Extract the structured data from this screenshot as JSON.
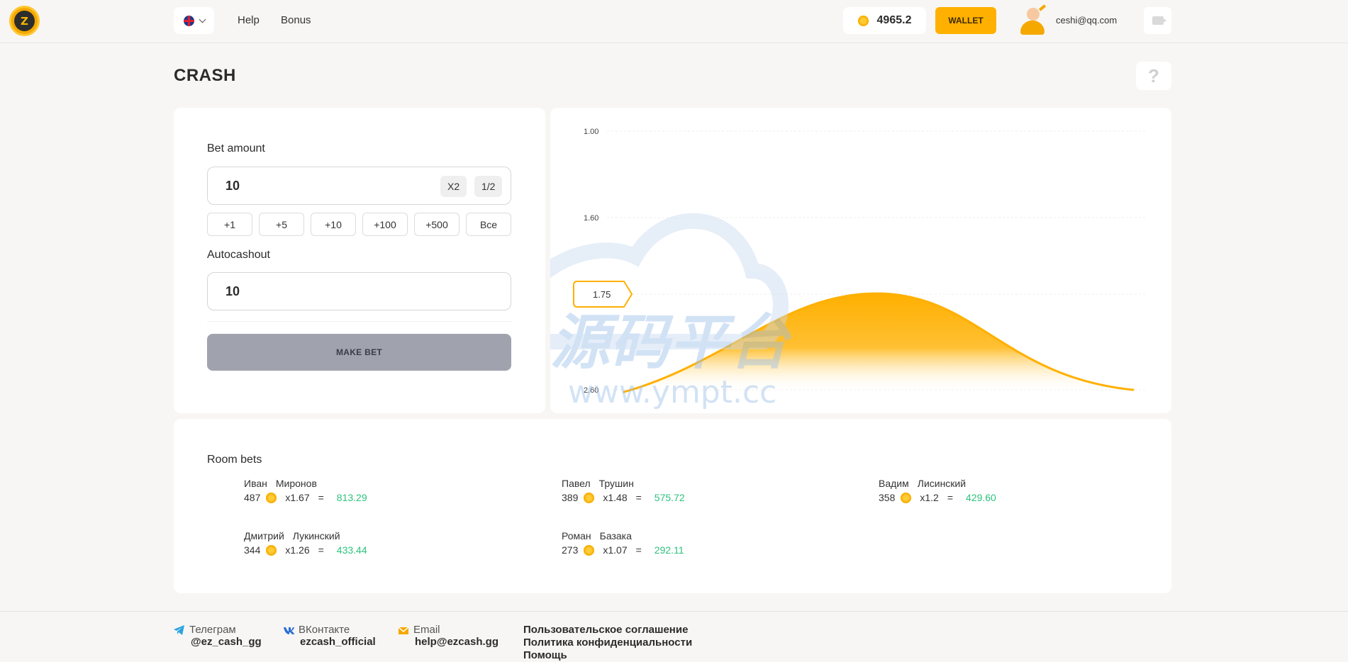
{
  "header": {
    "logo_text": "Z",
    "nav": [
      "Help",
      "Bonus"
    ],
    "balance": "4965.2",
    "wallet_label": "WALLET",
    "user_email": "ceshi@qq.com"
  },
  "page": {
    "title": "CRASH",
    "help_label": "?"
  },
  "bet_panel": {
    "bet_amount_label": "Bet amount",
    "bet_amount_value": "10",
    "x2_label": "X2",
    "half_label": "1/2",
    "quick_amounts": [
      "+1",
      "+5",
      "+10",
      "+100",
      "+500",
      "Все"
    ],
    "autocashout_label": "Autocashout",
    "autocashout_value": "10",
    "make_bet_label": "MAKE BET"
  },
  "chart_data": {
    "type": "area",
    "y_ticks": [
      "1.00",
      "1.60",
      "2.60"
    ],
    "current_multiplier": "1.75",
    "curve": "bell",
    "colors": {
      "line": "#ffb000",
      "fill_top": "#ffb000",
      "fill_bottom": "#ffffff"
    }
  },
  "watermark": {
    "text_cn": "源码平台",
    "url": "www.ympt.cc"
  },
  "room": {
    "title": "Room bets",
    "bets": [
      {
        "first": "Иван",
        "last": "Миронов",
        "amount": "487",
        "mult": "x1.67",
        "eq": "=",
        "win": "813.29"
      },
      {
        "first": "Павел",
        "last": "Трушин",
        "amount": "389",
        "mult": "x1.48",
        "eq": "=",
        "win": "575.72"
      },
      {
        "first": "Вадим",
        "last": "Лисинский",
        "amount": "358",
        "mult": "x1.2",
        "eq": "=",
        "win": "429.60"
      },
      {
        "first": "Дмитрий",
        "last": "Лукинский",
        "amount": "344",
        "mult": "x1.26",
        "eq": "=",
        "win": "433.44"
      },
      {
        "first": "Роман",
        "last": "Базака",
        "amount": "273",
        "mult": "x1.07",
        "eq": "=",
        "win": "292.11"
      }
    ]
  },
  "footer": {
    "telegram_label": "Телеграм",
    "telegram_value": "@ez_cash_gg",
    "vk_label": "ВКонтакте",
    "vk_value": "ezcash_official",
    "email_label": "Email",
    "email_value": "help@ezcash.gg",
    "links": [
      "Пользовательское соглашение",
      "Политика конфиденциальности",
      "Помощь"
    ]
  }
}
